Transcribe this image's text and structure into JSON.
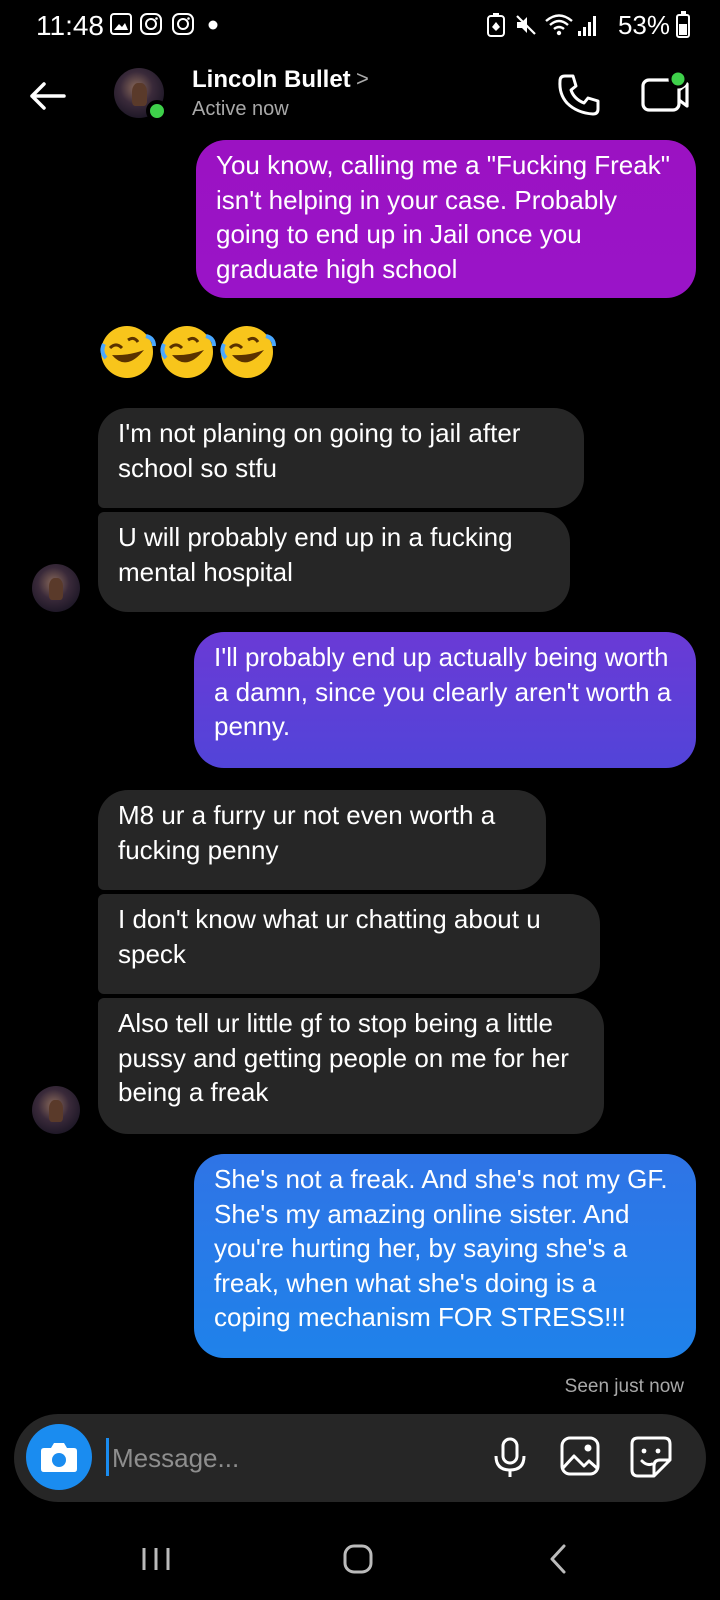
{
  "status_bar": {
    "time": "11:48",
    "battery": "53%",
    "icons": [
      "gallery-icon",
      "instagram-icon",
      "instagram-icon",
      "dot-icon",
      "battery-saver-icon",
      "mute-icon",
      "wifi-icon",
      "signal-icon",
      "battery-icon"
    ]
  },
  "header": {
    "contact_name": "Lincoln Bullet",
    "chevron": ">",
    "status": "Active now"
  },
  "messages": [
    {
      "type": "sent",
      "text": "You know, calling me a \"Fucking Freak\" isn't helping in your case. Probably going to end up in Jail once you graduate high school",
      "color": "#9b12c2"
    },
    {
      "type": "reaction",
      "emoji_count": 3,
      "emoji": "rolling-on-floor-laughing-emoji"
    },
    {
      "type": "received",
      "text": "I'm not planing on going to jail after school so stfu"
    },
    {
      "type": "received",
      "text": "U will probably end up in a fucking mental hospital"
    },
    {
      "type": "sent",
      "text": "I'll probably end up actually being worth a damn, since you clearly aren't worth a penny.",
      "color": "#5d3fd4"
    },
    {
      "type": "received",
      "text": "M8 ur a furry ur not even worth a fucking penny"
    },
    {
      "type": "received",
      "text": "I don't know what ur chatting about u speck"
    },
    {
      "type": "received",
      "text": "Also tell ur little gf to stop being a little pussy and getting people on me for her being a freak"
    },
    {
      "type": "sent",
      "text": "She's not a freak. And she's not my GF. She's my amazing online sister. And you're hurting her, by saying she's a freak, when what she's doing is a coping mechanism FOR STRESS!!!",
      "color": "#1f7de8"
    }
  ],
  "seen_text": "Seen just now",
  "composer": {
    "placeholder": "Message..."
  },
  "colors": {
    "received_bubble": "#262626",
    "accent_blue": "#1a8cf0",
    "online_green": "#3ed04a"
  }
}
